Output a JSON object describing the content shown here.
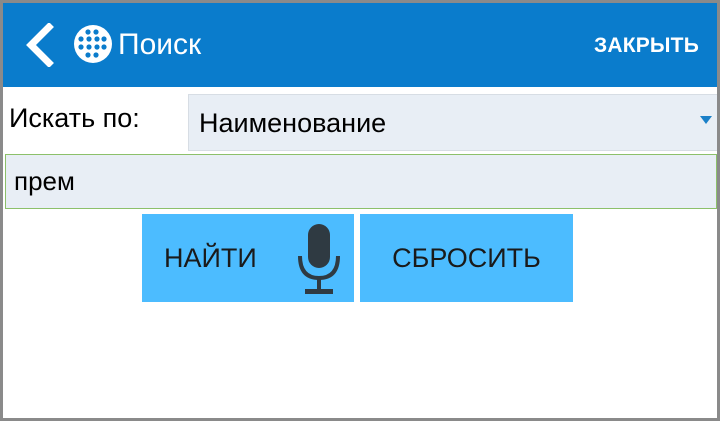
{
  "appbar": {
    "title": "Поиск",
    "close_label": "ЗАКРЫТЬ",
    "back_icon": "chevron-left-icon",
    "logo_icon": "dotted-circle-logo-icon",
    "color": "#0a7ccc"
  },
  "search_by": {
    "label": "Искать по:",
    "selected_value": "Наименование"
  },
  "query": {
    "value": "прем"
  },
  "buttons": {
    "find_label": "НАЙТИ",
    "reset_label": "СБРОСИТЬ",
    "color": "#4cbcff"
  },
  "icons": {
    "mic": "microphone-icon",
    "dropdown": "dropdown-arrow-icon"
  }
}
